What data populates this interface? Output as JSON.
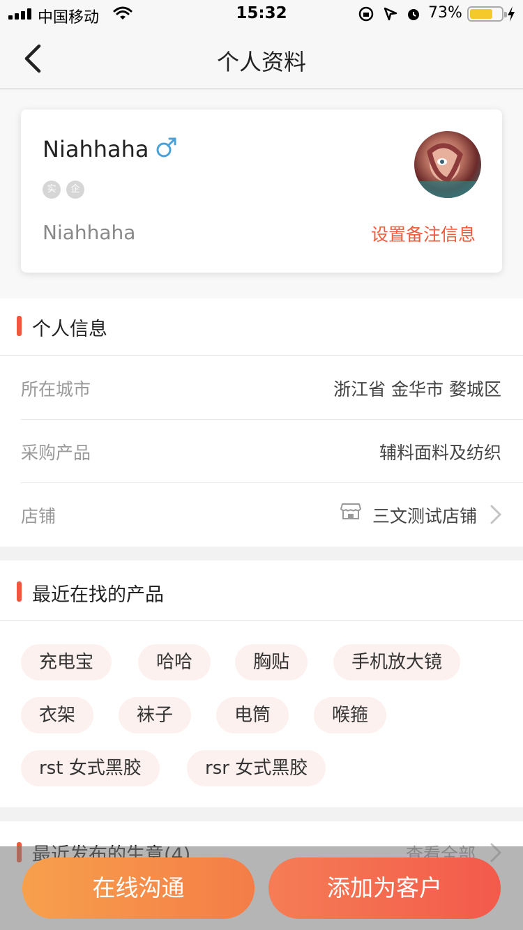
{
  "status_bar": {
    "carrier": "中国移动",
    "time": "15:32",
    "battery_percent": "73%",
    "battery_level": 0.73
  },
  "nav": {
    "title": "个人资料"
  },
  "profile": {
    "name": "Niahhaha",
    "gender_icon": "male-icon",
    "badges": [
      "实",
      "企"
    ],
    "nickname": "Niahhaha",
    "remark_link": "设置备注信息"
  },
  "personal_info": {
    "title": "个人信息",
    "rows": [
      {
        "label": "所在城市",
        "value": "浙江省 金华市 婺城区"
      },
      {
        "label": "采购产品",
        "value": "辅料面料及纺织"
      },
      {
        "label": "店铺",
        "value": "三文测试店铺"
      }
    ]
  },
  "recent_products": {
    "title": "最近在找的产品",
    "tags": [
      "充电宝",
      "哈哈",
      "胸贴",
      "手机放大镜",
      "衣架",
      "袜子",
      "电筒",
      "喉箍",
      "rst 女式黑胶",
      "rsr 女式黑胶"
    ]
  },
  "recent_posts": {
    "title": "最近发布的生意(4)",
    "more": "查看全部"
  },
  "actions": {
    "chat": "在线沟通",
    "add_customer": "添加为客户"
  },
  "colors": {
    "accent": "#f0573c",
    "tag_bg": "#fdf1ef",
    "chat_gradient": [
      "#f7a04c",
      "#f47d47"
    ],
    "add_gradient": [
      "#f57d55",
      "#f35a4b"
    ],
    "battery": "#f6c92a"
  }
}
